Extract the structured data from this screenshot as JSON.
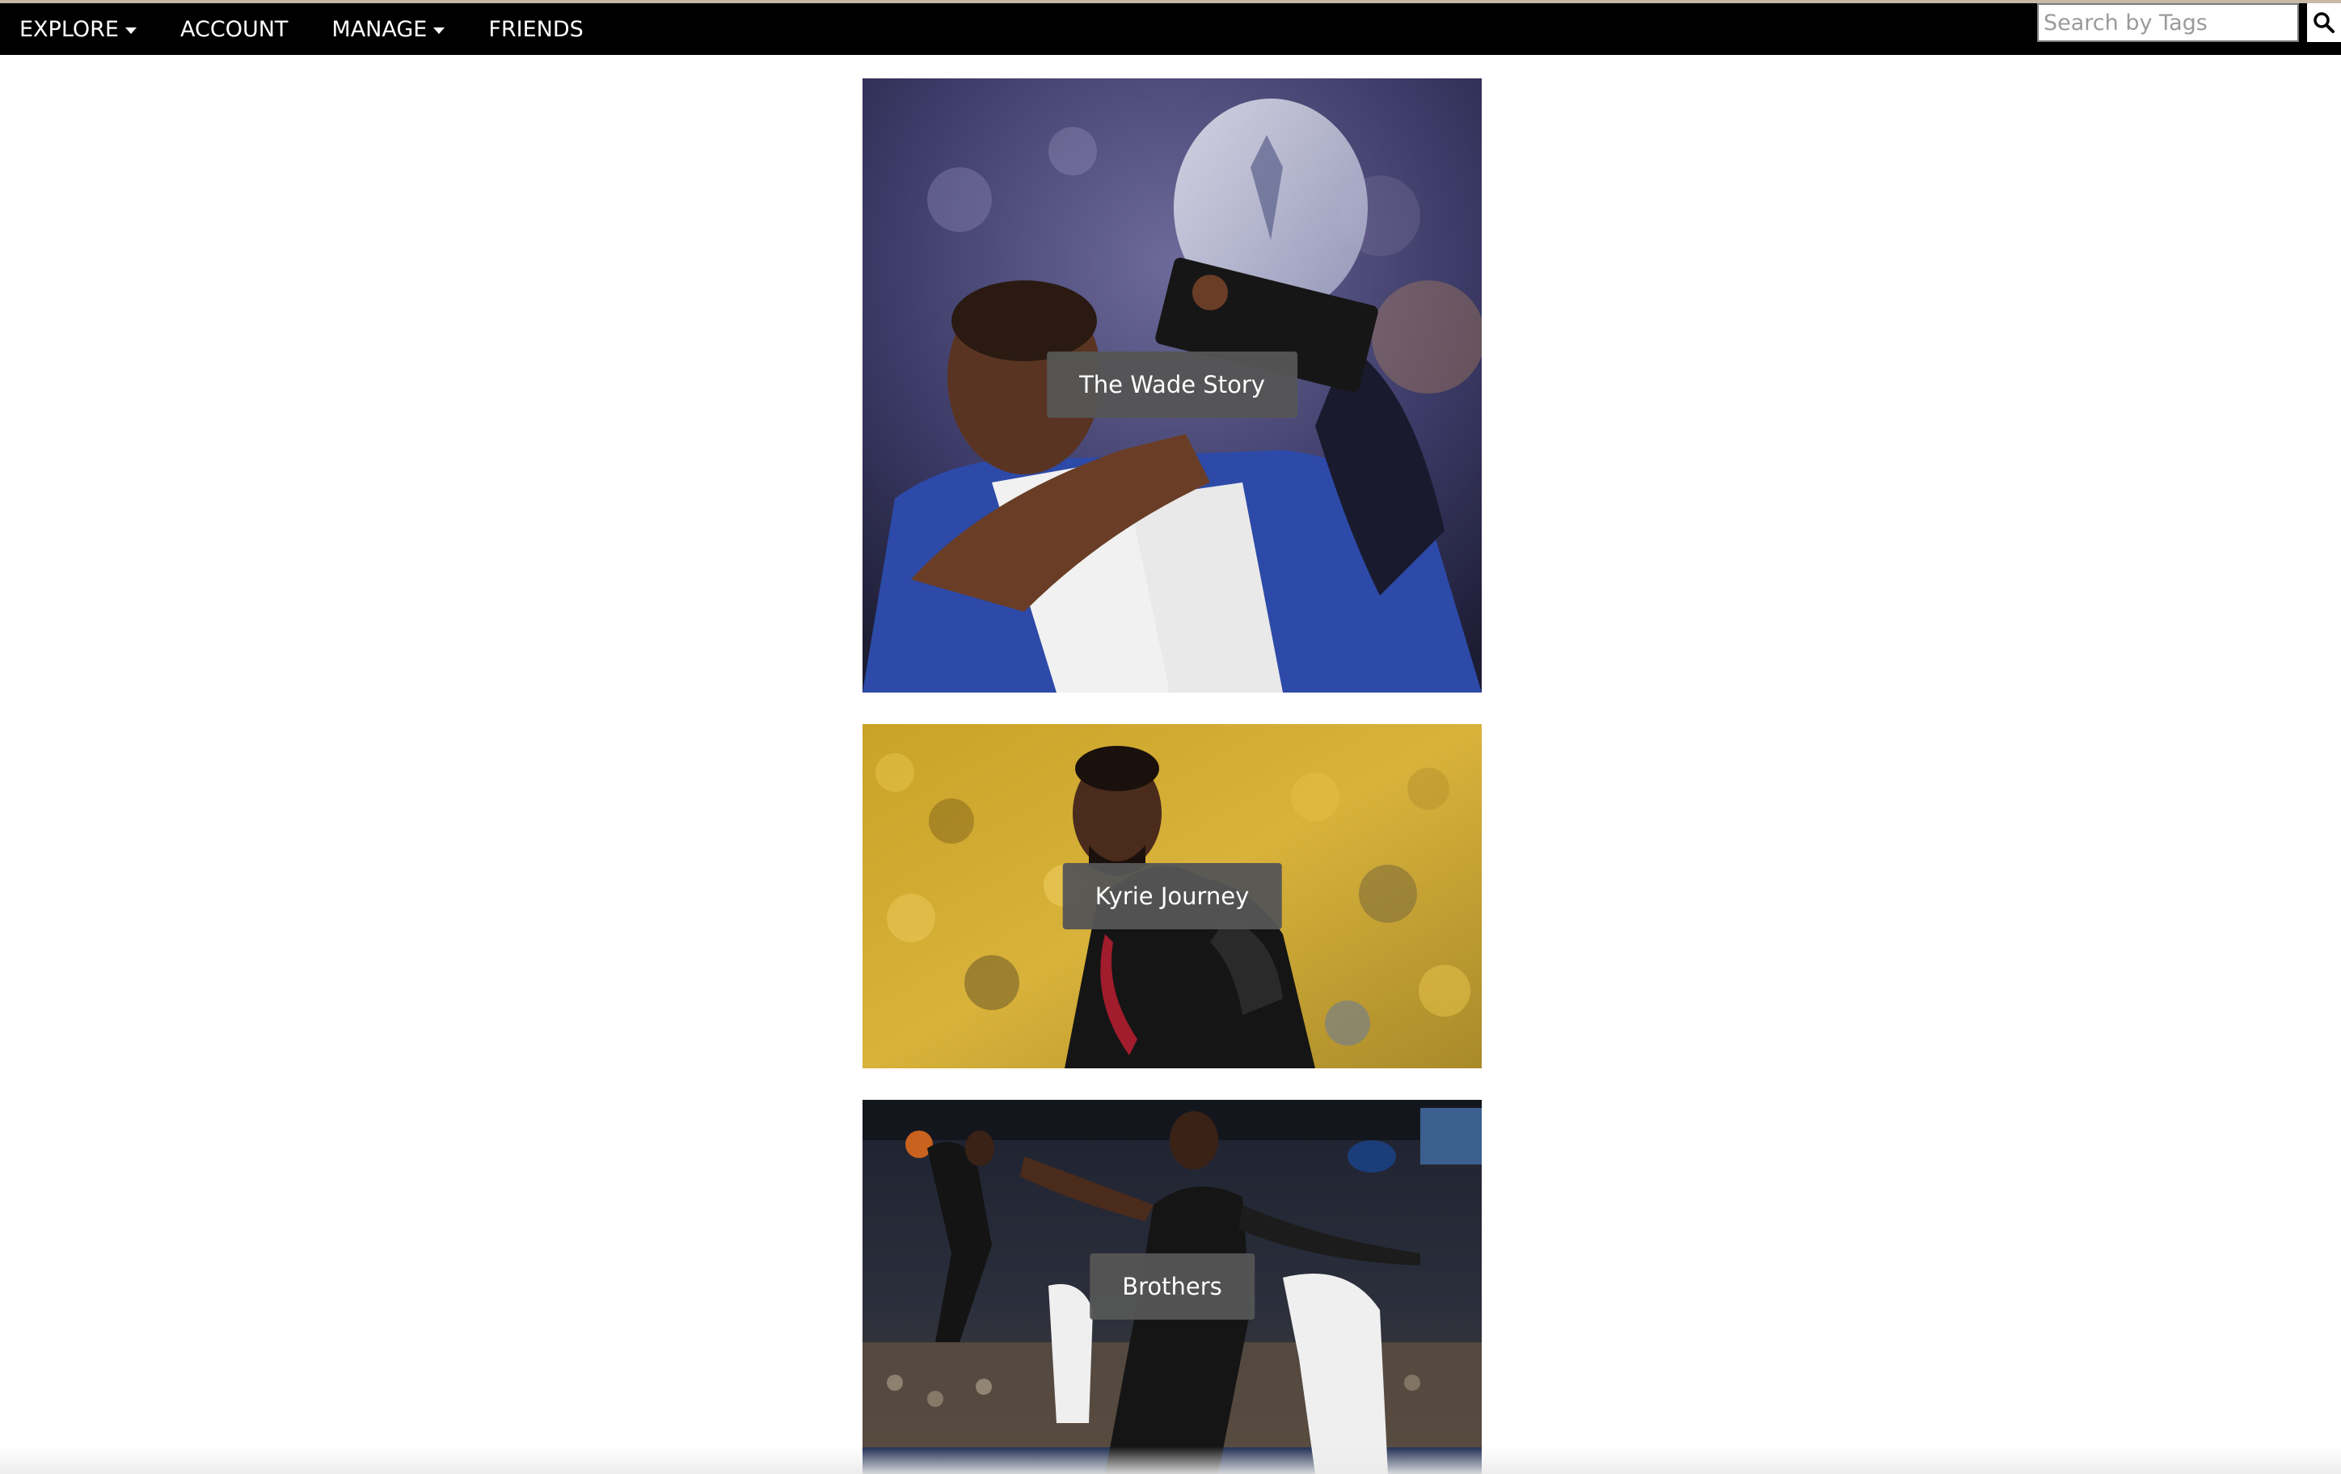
{
  "nav": {
    "items": [
      {
        "label": "EXPLORE",
        "has_dropdown": true
      },
      {
        "label": "ACCOUNT",
        "has_dropdown": false
      },
      {
        "label": "MANAGE",
        "has_dropdown": true
      },
      {
        "label": "FRIENDS",
        "has_dropdown": false
      }
    ]
  },
  "search": {
    "placeholder": "Search by Tags",
    "value": "",
    "icon": "search-icon"
  },
  "feed": {
    "cards": [
      {
        "title": "The Wade Story"
      },
      {
        "title": "Kyrie Journey"
      },
      {
        "title": "Brothers"
      }
    ]
  },
  "colors": {
    "topbar": "#000000",
    "label_bg": "#555555",
    "text_light": "#ffffff"
  }
}
